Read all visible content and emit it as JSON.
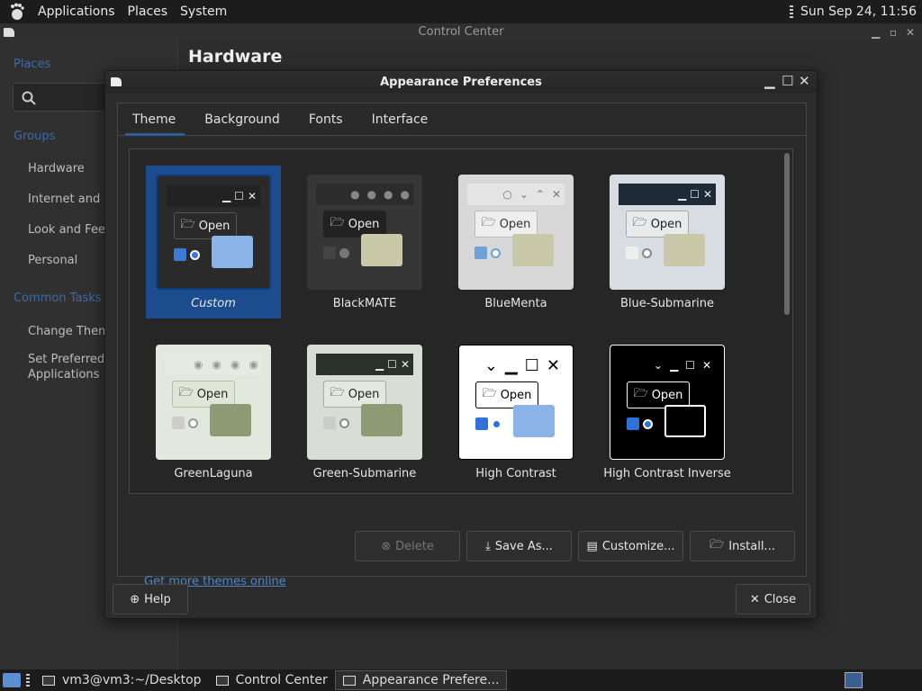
{
  "topbar": {
    "menus": [
      "Applications",
      "Places",
      "System"
    ],
    "clock": "Sun Sep 24, 11:56"
  },
  "control_center": {
    "title": "Control Center",
    "section_title": "Hardware",
    "sidebar": {
      "heading1": "Places",
      "heading2": "Groups",
      "items": [
        "Hardware",
        "Internet and N",
        "Look and Feel",
        "Personal"
      ],
      "heading3": "Common Tasks",
      "tasks": [
        "Change Them",
        "Set Preferred",
        "Applications"
      ]
    }
  },
  "dialog": {
    "title": "Appearance Preferences",
    "tabs": [
      "Theme",
      "Background",
      "Fonts",
      "Interface"
    ],
    "themes": [
      {
        "name": "Custom",
        "selected": true
      },
      {
        "name": "BlackMATE"
      },
      {
        "name": "BlueMenta"
      },
      {
        "name": "Blue-Submarine"
      },
      {
        "name": "GreenLaguna"
      },
      {
        "name": "Green-Submarine"
      },
      {
        "name": "High Contrast"
      },
      {
        "name": "High Contrast Inverse"
      }
    ],
    "open_label": "Open",
    "buttons": {
      "delete": "Delete",
      "save_as": "Save As...",
      "customize": "Customize...",
      "install": "Install..."
    },
    "link": "Get more themes online",
    "help": "Help",
    "close": "Close"
  },
  "taskbar": {
    "tasks": [
      "vm3@vm3:~/Desktop",
      "Control Center",
      "Appearance Prefere..."
    ]
  }
}
